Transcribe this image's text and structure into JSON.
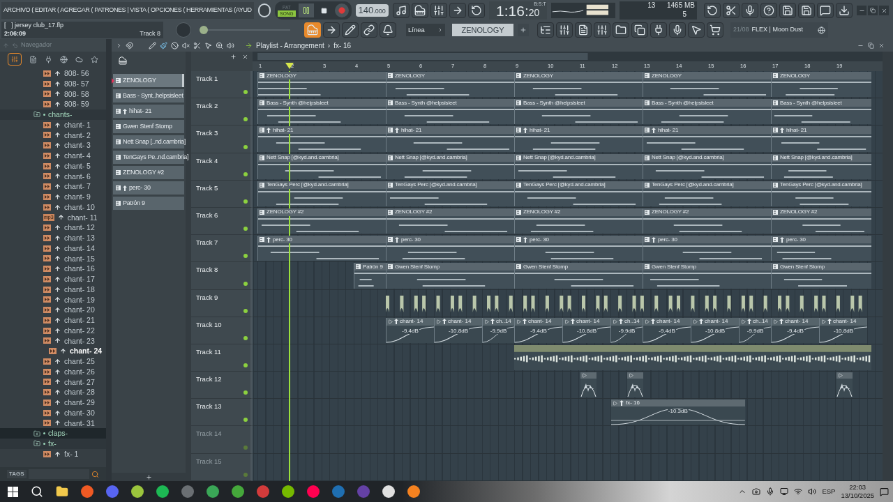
{
  "menu": {
    "text": "ARCHIVO ( EDITAR ( AGREGAR ( PATRONES | VISTA ( OPCIONES ( HERRAMIENTAS (AYUD"
  },
  "hint_panel": {
    "file": "[   ] jersey club_17.flp",
    "time": "2:06:09",
    "track": "Track 8"
  },
  "pitch_slider": {
    "level": 0
  },
  "transport": {
    "modes": [
      {
        "label": "PAT",
        "selected": false
      },
      {
        "label": "SONG",
        "selected": true
      }
    ],
    "tempo_whole": "140",
    "tempo_fraction": ".000"
  },
  "clock": {
    "main": "1:16:",
    "small": "20",
    "unit": "B:S:T"
  },
  "monitor": {
    "cpu": "13",
    "memory": "1465 MB",
    "polyphony": "5"
  },
  "snap": "Línea",
  "pattern_selector": "ZENOLOGY",
  "news": {
    "date": "21/08",
    "title": "FLEX | Moon Dust"
  },
  "browser": {
    "title": "Navegador",
    "tags_label": "TAGS",
    "items": [
      {
        "label": "808- 56",
        "kind": "audio",
        "selected": false
      },
      {
        "label": "808- 57",
        "kind": "audio",
        "selected": false
      },
      {
        "label": "808- 58",
        "kind": "audio",
        "selected": false
      },
      {
        "label": "808- 59",
        "kind": "audio",
        "selected": false
      },
      {
        "label": "chants-",
        "kind": "folder",
        "expanded": true,
        "selected": false,
        "children": [
          {
            "label": "chant- 1",
            "kind": "audio",
            "selected": false
          },
          {
            "label": "chant- 2",
            "kind": "audio",
            "selected": false
          },
          {
            "label": "chant- 3",
            "kind": "audio",
            "selected": false
          },
          {
            "label": "chant- 4",
            "kind": "audio",
            "selected": false
          },
          {
            "label": "chant- 5",
            "kind": "audio",
            "selected": false
          },
          {
            "label": "chant- 6",
            "kind": "audio",
            "selected": false
          },
          {
            "label": "chant- 7",
            "kind": "audio",
            "selected": false
          },
          {
            "label": "chant- 9",
            "kind": "audio",
            "selected": false
          },
          {
            "label": "chant- 10",
            "kind": "audio",
            "selected": false
          },
          {
            "label": "chant- 11",
            "kind": "audio",
            "badge": "mp3",
            "selected": false
          },
          {
            "label": "chant- 12",
            "kind": "audio",
            "selected": false
          },
          {
            "label": "chant- 13",
            "kind": "audio",
            "selected": false
          },
          {
            "label": "chant- 14",
            "kind": "audio",
            "selected": false
          },
          {
            "label": "chant- 15",
            "kind": "audio",
            "selected": false
          },
          {
            "label": "chant- 16",
            "kind": "audio",
            "selected": false
          },
          {
            "label": "chant- 17",
            "kind": "audio",
            "selected": false
          },
          {
            "label": "chant- 18",
            "kind": "audio",
            "selected": false
          },
          {
            "label": "chant- 19",
            "kind": "audio",
            "selected": false
          },
          {
            "label": "chant- 20",
            "kind": "audio",
            "selected": false
          },
          {
            "label": "chant- 21",
            "kind": "audio",
            "selected": false
          },
          {
            "label": "chant- 22",
            "kind": "audio",
            "selected": false
          },
          {
            "label": "chant- 23",
            "kind": "audio",
            "selected": false
          },
          {
            "label": "chant- 24",
            "kind": "audio",
            "selected": true
          },
          {
            "label": "chant- 25",
            "kind": "audio",
            "selected": false
          },
          {
            "label": "chant- 26",
            "kind": "audio",
            "selected": false
          },
          {
            "label": "chant- 27",
            "kind": "audio",
            "selected": false
          },
          {
            "label": "chant- 28",
            "kind": "audio",
            "selected": false
          },
          {
            "label": "chant- 29",
            "kind": "audio",
            "selected": false
          },
          {
            "label": "chant- 30",
            "kind": "audio",
            "selected": false
          },
          {
            "label": "chant- 31",
            "kind": "audio",
            "selected": false
          }
        ]
      },
      {
        "label": "claps-",
        "kind": "folder",
        "expanded": false,
        "selected": false
      },
      {
        "label": "fx-",
        "kind": "folder",
        "expanded": true,
        "selected": false,
        "children": [
          {
            "label": "fx- 1",
            "kind": "audio",
            "selected": false
          }
        ]
      }
    ]
  },
  "patterns": [
    {
      "label": "ZENOLOGY",
      "sampled": false,
      "selected": true
    },
    {
      "label": "Bass - Synt..helpsisleet",
      "sampled": false,
      "selected": false
    },
    {
      "label": "hihat- 21",
      "sampled": true,
      "selected": false
    },
    {
      "label": "Gwen Stenf Stomp",
      "sampled": false,
      "selected": false
    },
    {
      "label": "Nett Snap [..nd.cambria]",
      "sampled": false,
      "selected": false
    },
    {
      "label": "TenGays Pe..nd.cambria]",
      "sampled": false,
      "selected": false
    },
    {
      "label": "ZENOLOGY #2",
      "sampled": false,
      "selected": false
    },
    {
      "label": "perc- 30",
      "sampled": true,
      "selected": false
    },
    {
      "label": "Patrón 9",
      "sampled": false,
      "selected": false
    }
  ],
  "playlist": {
    "title": "Playlist - Arrangement",
    "separator": "›",
    "current": "fx- 16",
    "ruler": [
      "1",
      "2",
      "3",
      "4",
      "5",
      "6",
      "7",
      "8",
      "9",
      "10",
      "11",
      "12",
      "13",
      "14",
      "15",
      "16",
      "17",
      "18",
      "19"
    ],
    "tracks": [
      {
        "name": "Track 1",
        "kind": "pattern",
        "disabled": false,
        "clips": [
          {
            "label": "ZENOLOGY",
            "sampled": false
          },
          {
            "label": "ZENOLOGY",
            "sampled": false
          },
          {
            "label": "ZENOLOGY",
            "sampled": false
          },
          {
            "label": "ZENOLOGY",
            "sampled": false
          },
          {
            "label": "ZENOLOGY",
            "sampled": false
          }
        ]
      },
      {
        "name": "Track 2",
        "kind": "pattern",
        "disabled": false,
        "clips": [
          {
            "label": "Bass - Synth @helpsisleet",
            "sampled": false
          },
          {
            "label": "Bass - Synth @helpsisleet",
            "sampled": false
          },
          {
            "label": "Bass - Synth @helpsisleet",
            "sampled": false
          },
          {
            "label": "Bass - Synth @helpsisleet",
            "sampled": false
          },
          {
            "label": "Bass - Synth @helpsisleet",
            "sampled": false
          }
        ]
      },
      {
        "name": "Track 3",
        "kind": "pattern",
        "disabled": false,
        "clips": [
          {
            "label": "hihat- 21",
            "sampled": true
          },
          {
            "label": "hihat- 21",
            "sampled": true
          },
          {
            "label": "hihat- 21",
            "sampled": true
          },
          {
            "label": "hihat- 21",
            "sampled": true
          },
          {
            "label": "hihat- 21",
            "sampled": true
          }
        ]
      },
      {
        "name": "Track 4",
        "kind": "pattern",
        "disabled": false,
        "clips": [
          {
            "label": "Nett Snap [@kyd.and.cambria]",
            "sampled": false
          },
          {
            "label": "Nett Snap [@kyd.and.cambria]",
            "sampled": false
          },
          {
            "label": "Nett Snap [@kyd.and.cambria]",
            "sampled": false
          },
          {
            "label": "Nett Snap [@kyd.and.cambria]",
            "sampled": false
          },
          {
            "label": "Nett Snap [@kyd.and.cambria]",
            "sampled": false
          }
        ]
      },
      {
        "name": "Track 5",
        "kind": "pattern",
        "disabled": false,
        "clips": [
          {
            "label": "TenGays Perc [@kyd.and.cambria]",
            "sampled": false
          },
          {
            "label": "TenGays Perc [@kyd.and.cambria]",
            "sampled": false
          },
          {
            "label": "TenGays Perc [@kyd.and.cambria]",
            "sampled": false
          },
          {
            "label": "TenGays Perc [@kyd.and.cambria]",
            "sampled": false
          },
          {
            "label": "TenGays Perc [@kyd.and.cambria]",
            "sampled": false
          }
        ]
      },
      {
        "name": "Track 6",
        "kind": "pattern",
        "disabled": false,
        "clips": [
          {
            "label": "ZENOLOGY #2",
            "sampled": false
          },
          {
            "label": "ZENOLOGY #2",
            "sampled": false
          },
          {
            "label": "ZENOLOGY #2",
            "sampled": false
          },
          {
            "label": "ZENOLOGY #2",
            "sampled": false
          },
          {
            "label": "ZENOLOGY #2",
            "sampled": false
          }
        ]
      },
      {
        "name": "Track 7",
        "kind": "pattern",
        "disabled": false,
        "clips": [
          {
            "label": "perc- 30",
            "sampled": true
          },
          {
            "label": "perc- 30",
            "sampled": true
          },
          {
            "label": "perc- 30",
            "sampled": true
          },
          {
            "label": "perc- 30",
            "sampled": true
          },
          {
            "label": "perc- 30",
            "sampled": true
          }
        ]
      },
      {
        "name": "Track 8",
        "kind": "pattern",
        "disabled": false,
        "clips": [
          {
            "label": "Patrón 9",
            "sampled": false
          },
          {
            "label": "Gwen Stenf Stomp",
            "sampled": false
          },
          {
            "label": "Gwen Stenf Stomp",
            "sampled": false
          },
          {
            "label": "Gwen Stenf Stomp",
            "sampled": false
          },
          {
            "label": "Gwen Stenf Stomp",
            "sampled": false
          }
        ]
      },
      {
        "name": "Track 9",
        "kind": "slices",
        "disabled": false
      },
      {
        "name": "Track 10",
        "kind": "chain",
        "disabled": false,
        "clips": [
          {
            "label": "chant- 14",
            "reading": "-9.4dB"
          },
          {
            "label": "chant- 14",
            "reading": "-10.8dB"
          },
          {
            "label": "ch..14",
            "reading": "-9.9dB"
          },
          {
            "label": "chant- 14",
            "reading": "-9.4dB"
          },
          {
            "label": "chant- 14",
            "reading": "-10.8dB"
          },
          {
            "label": "ch..14",
            "reading": "-9.9dB"
          },
          {
            "label": "chant- 14",
            "reading": "-9.4dB"
          },
          {
            "label": "chant- 14",
            "reading": "-10.8dB"
          },
          {
            "label": "ch..14",
            "reading": "-9.9dB"
          },
          {
            "label": "chant- 14",
            "reading": "-9.4dB"
          },
          {
            "label": "chant- 14",
            "reading": "-10.8dB"
          }
        ]
      },
      {
        "name": "Track 11",
        "kind": "long_audio",
        "disabled": false
      },
      {
        "name": "Track 12",
        "kind": "short_audio",
        "disabled": false
      },
      {
        "name": "Track 13",
        "kind": "fade",
        "disabled": false,
        "clips": [
          {
            "label": "fx- 16",
            "reading": "-10.3dB"
          }
        ]
      },
      {
        "name": "Track 14",
        "kind": "empty",
        "disabled": true
      },
      {
        "name": "Track 15",
        "kind": "empty",
        "disabled": true
      }
    ]
  },
  "taskbar": {
    "language": "ESP",
    "time": "22:03",
    "date": "13/10/2025"
  }
}
